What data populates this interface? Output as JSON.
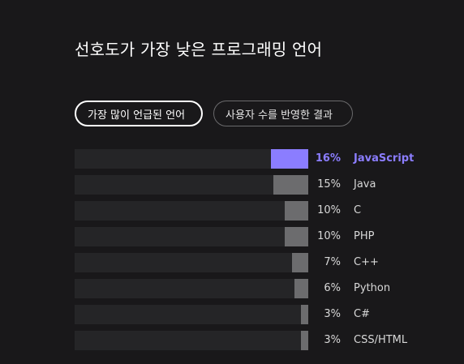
{
  "title": "선호도가 가장 낮은 프로그래밍 언어",
  "toggle": {
    "active_label": "가장 많이 언급된 언어",
    "inactive_label": "사용자 수를 반영한 결과"
  },
  "colors": {
    "highlight": "#8b7dff",
    "bar": "#6c6c6e",
    "track": "#252527",
    "background": "#19181a"
  },
  "chart_data": {
    "type": "bar",
    "categories": [
      "JavaScript",
      "Java",
      "C",
      "PHP",
      "C++",
      "Python",
      "C#",
      "CSS/HTML"
    ],
    "values": [
      16,
      15,
      10,
      10,
      7,
      6,
      3,
      3
    ],
    "value_labels": [
      "16%",
      "15%",
      "10%",
      "10%",
      "7%",
      "6%",
      "3%",
      "3%"
    ],
    "highlighted": "JavaScript",
    "unit": "%",
    "xlim": [
      0,
      100
    ]
  }
}
